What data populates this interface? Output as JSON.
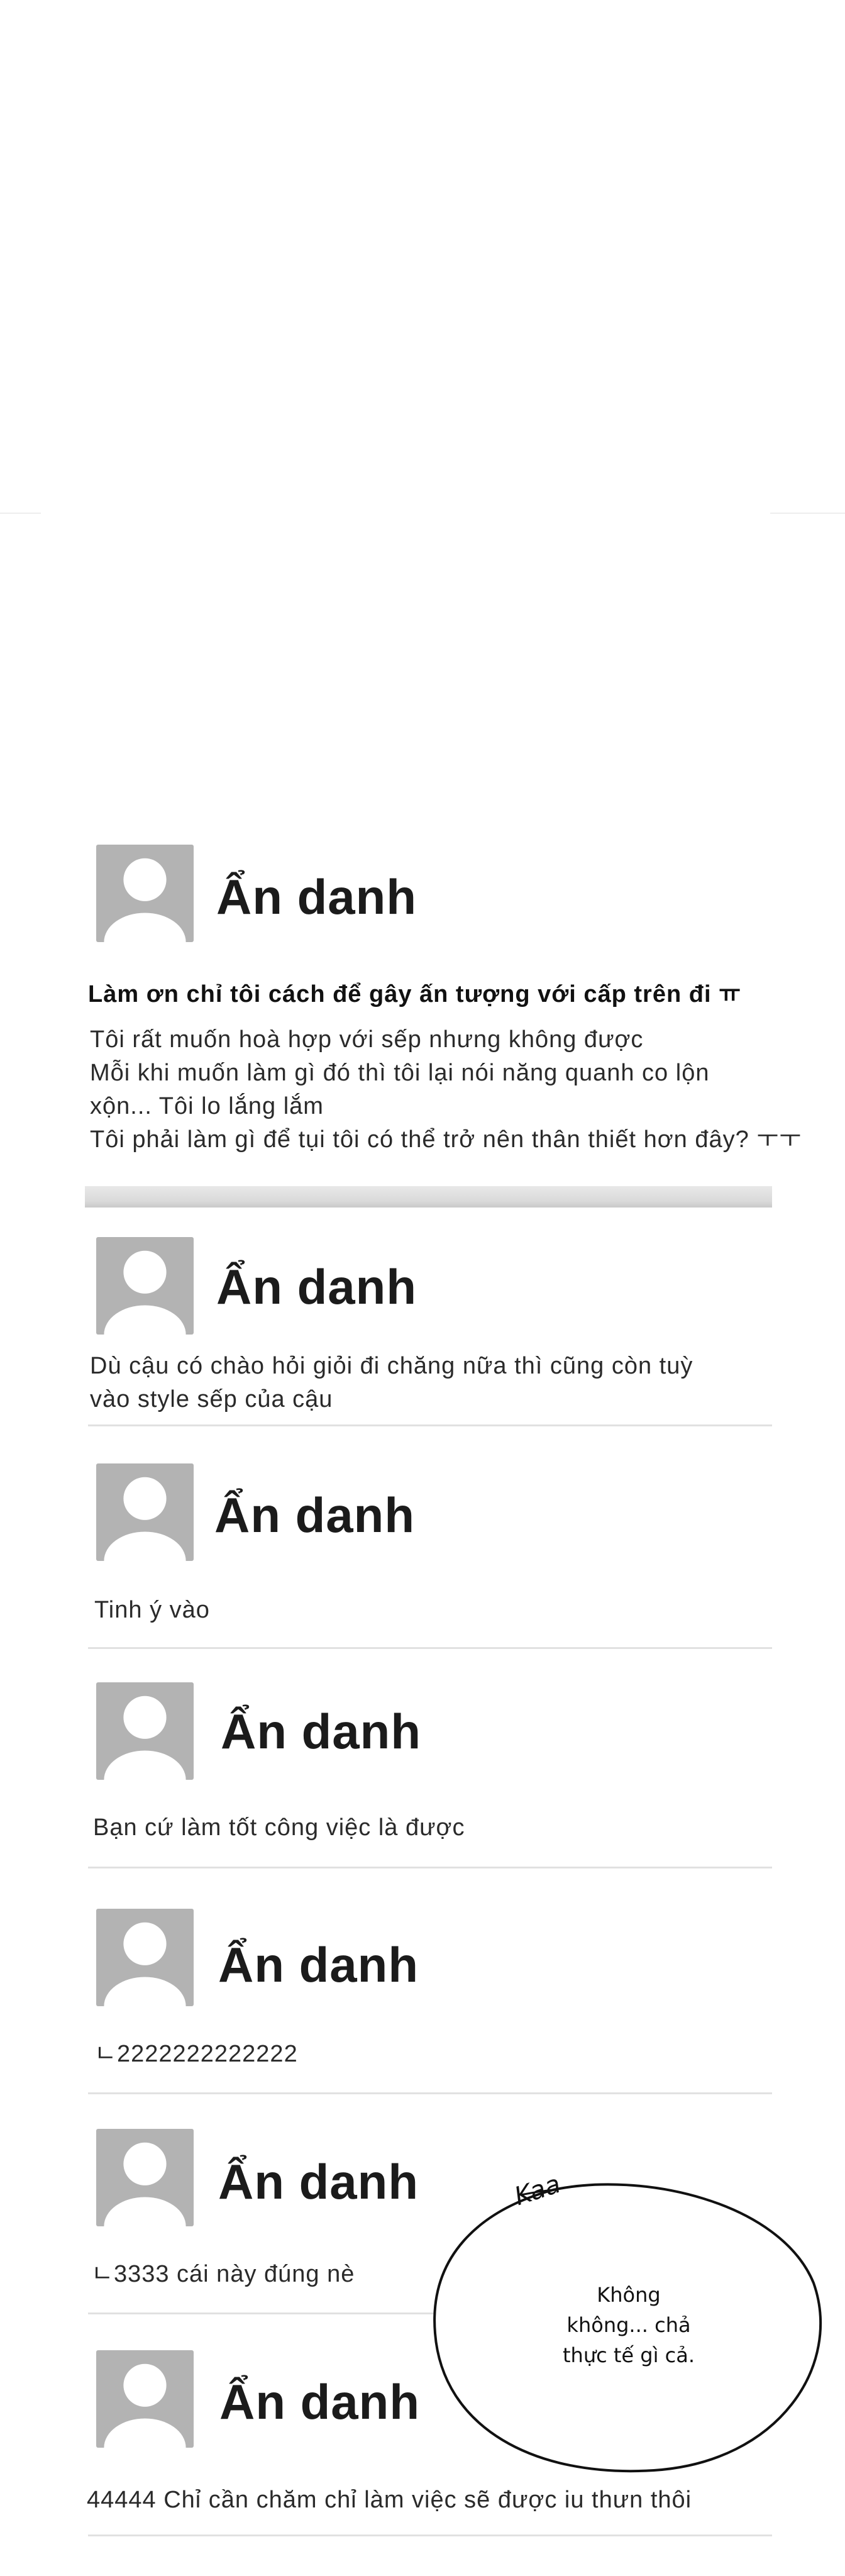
{
  "post": {
    "author": "Ẩn danh",
    "title": "Làm ơn chỉ tôi cách để gây ấn tượng với cấp trên đi ㅠ",
    "body_lines": [
      "Tôi rất muốn hoà hợp với sếp nhưng không được",
      "Mỗi khi muốn làm gì đó thì tôi lại nói năng quanh co lộn",
      "xộn... Tôi lo lắng lắm",
      "Tôi phải làm gì để tụi tôi có thể trở nên thân thiết hơn đây? ㅜㅜ"
    ]
  },
  "comments": [
    {
      "author": "Ẩn danh",
      "lines": [
        "Dù cậu có chào hỏi giỏi đi chăng nữa thì cũng còn tuỳ",
        "vào style sếp của cậu"
      ]
    },
    {
      "author": "Ẩn danh",
      "lines": [
        "Tinh ý vào"
      ]
    },
    {
      "author": "Ẩn danh",
      "lines": [
        "Bạn cứ làm tốt công việc là được"
      ]
    },
    {
      "author": "Ẩn danh",
      "lines": [
        "ㄴ2222222222222"
      ]
    },
    {
      "author": "Ẩn danh",
      "lines": [
        "ㄴ3333 cái này đúng nè"
      ]
    },
    {
      "author": "Ẩn danh",
      "lines": [
        "44444 Chỉ cần chăm chỉ làm việc sẽ được iu thưn thôi"
      ]
    }
  ],
  "speech_bubble": {
    "sfx": "Kaa",
    "lines": [
      "Không",
      "không... chả",
      "thực tế gì cả."
    ]
  },
  "icons": {
    "avatar": "default-user-avatar-icon"
  },
  "colors": {
    "avatar_bg": "#b3b3b3",
    "divider": "#e1e1e1",
    "text": "#1f1f1f"
  }
}
